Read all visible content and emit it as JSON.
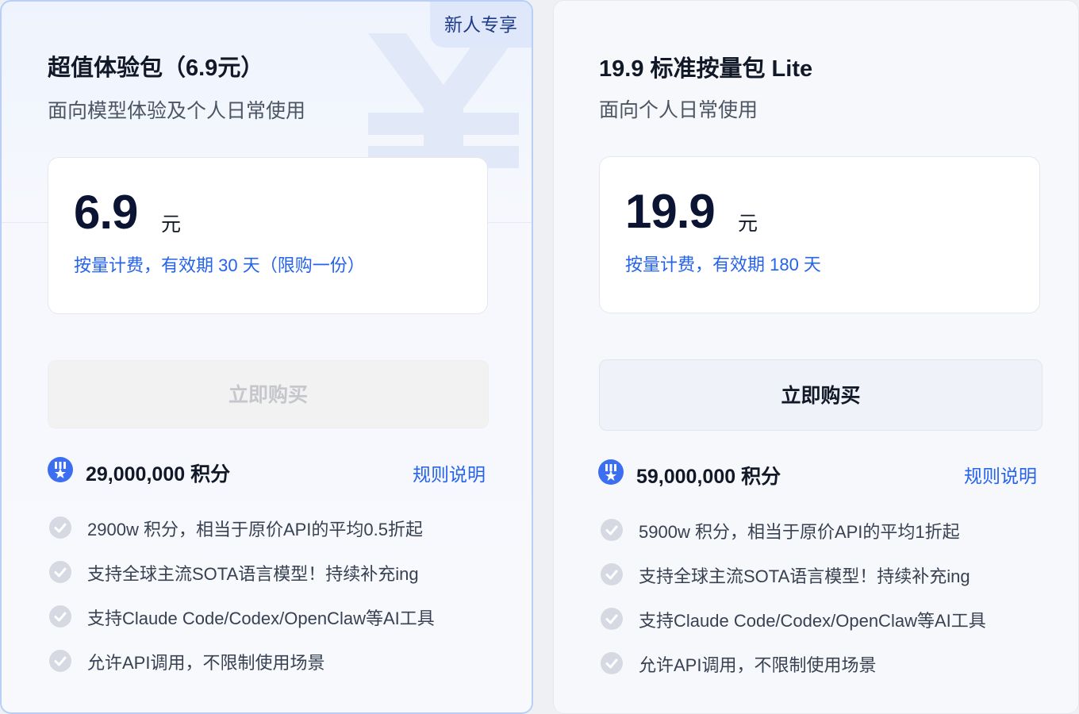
{
  "plans": [
    {
      "badge": "新人专享",
      "title": "超值体验包（6.9元）",
      "subtitle": "面向模型体验及个人日常使用",
      "price": "6.9",
      "unit": "元",
      "note": "按量计费，有效期 30 天（限购一份）",
      "buy_label": "立即购买",
      "buy_disabled": true,
      "credits": "29,000,000 积分",
      "rules_label": "规则说明",
      "features": [
        "2900w 积分，相当于原价API的平均0.5折起",
        "支持全球主流SOTA语言模型！持续补充ing",
        "支持Claude Code/Codex/OpenClaw等AI工具",
        "允许API调用，不限制使用场景"
      ]
    },
    {
      "title": "19.9 标准按量包 Lite",
      "subtitle": "面向个人日常使用",
      "price": "19.9",
      "unit": "元",
      "note": "按量计费，有效期 180 天",
      "buy_label": "立即购买",
      "buy_disabled": false,
      "credits": "59,000,000 积分",
      "rules_label": "规则说明",
      "features": [
        "5900w 积分，相当于原价API的平均1折起",
        "支持全球主流SOTA语言模型！持续补充ing",
        "支持Claude Code/Codex/OpenClaw等AI工具",
        "允许API调用，不限制使用场景"
      ]
    }
  ],
  "colors": {
    "accent": "#2563eb",
    "badge_bg": "#dfe8fb",
    "medal": "#3b6ef0",
    "check_bg": "#d6d9e2"
  },
  "icons": {
    "badge_watermark": "yen-watermark-icon",
    "credits": "medal-icon",
    "feature": "check-circle-icon"
  }
}
